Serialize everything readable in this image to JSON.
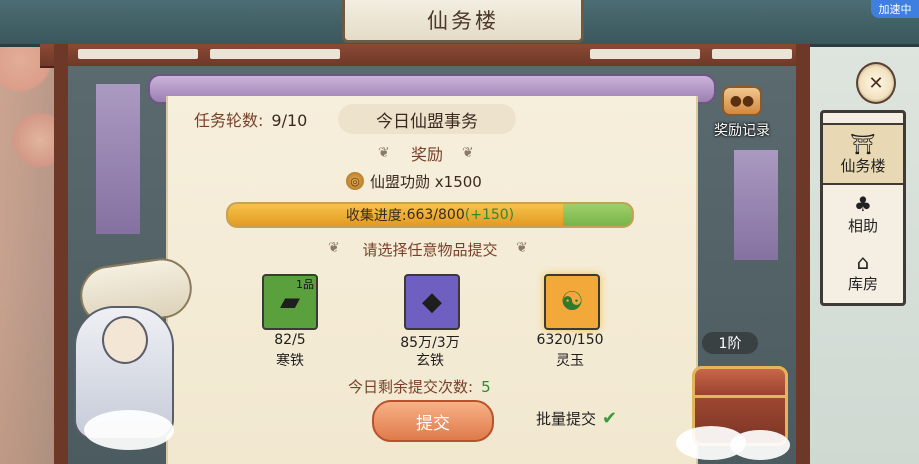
{
  "window": {
    "title": "仙务楼",
    "speed_badge": "加速中"
  },
  "panel": {
    "rounds_label": "任务轮数:",
    "rounds_value": "9/10",
    "title": "今日仙盟事务",
    "reward_header": "奖励",
    "reward_item": "仙盟功勋 x1500",
    "progress": {
      "label": "收集进度:",
      "current": 663,
      "total": 800,
      "text": "663/800",
      "bonus_text": "(+150)",
      "bonus": 150
    },
    "choose_header": "请选择任意物品提交",
    "items": [
      {
        "name": "寒铁",
        "count_text": "82/5",
        "grade": "1品",
        "icon": "iron-ingot-icon",
        "bg": "#5aa03c"
      },
      {
        "name": "玄铁",
        "count_text": "85万/3万",
        "grade": "",
        "icon": "dark-iron-icon",
        "bg": "#6f5fc0"
      },
      {
        "name": "灵玉",
        "count_text": "6320/150",
        "grade": "",
        "icon": "jade-icon",
        "bg": "#f2a93a"
      }
    ],
    "remaining_label": "今日剩余提交次数:",
    "remaining_value": "5",
    "submit_label": "提交",
    "batch_label": "批量提交"
  },
  "side": {
    "records_label": "奖励记录",
    "tier_label": "1阶",
    "tabs": [
      {
        "label": "仙务楼",
        "icon": "pavilion-icon",
        "active": true
      },
      {
        "label": "相助",
        "icon": "help-icon",
        "active": false
      },
      {
        "label": "库房",
        "icon": "storehouse-icon",
        "active": false
      }
    ]
  },
  "colors": {
    "accent_orange": "#e07a4c",
    "text_brown": "#7a3f2a",
    "bonus_green": "#2f8a2f"
  }
}
